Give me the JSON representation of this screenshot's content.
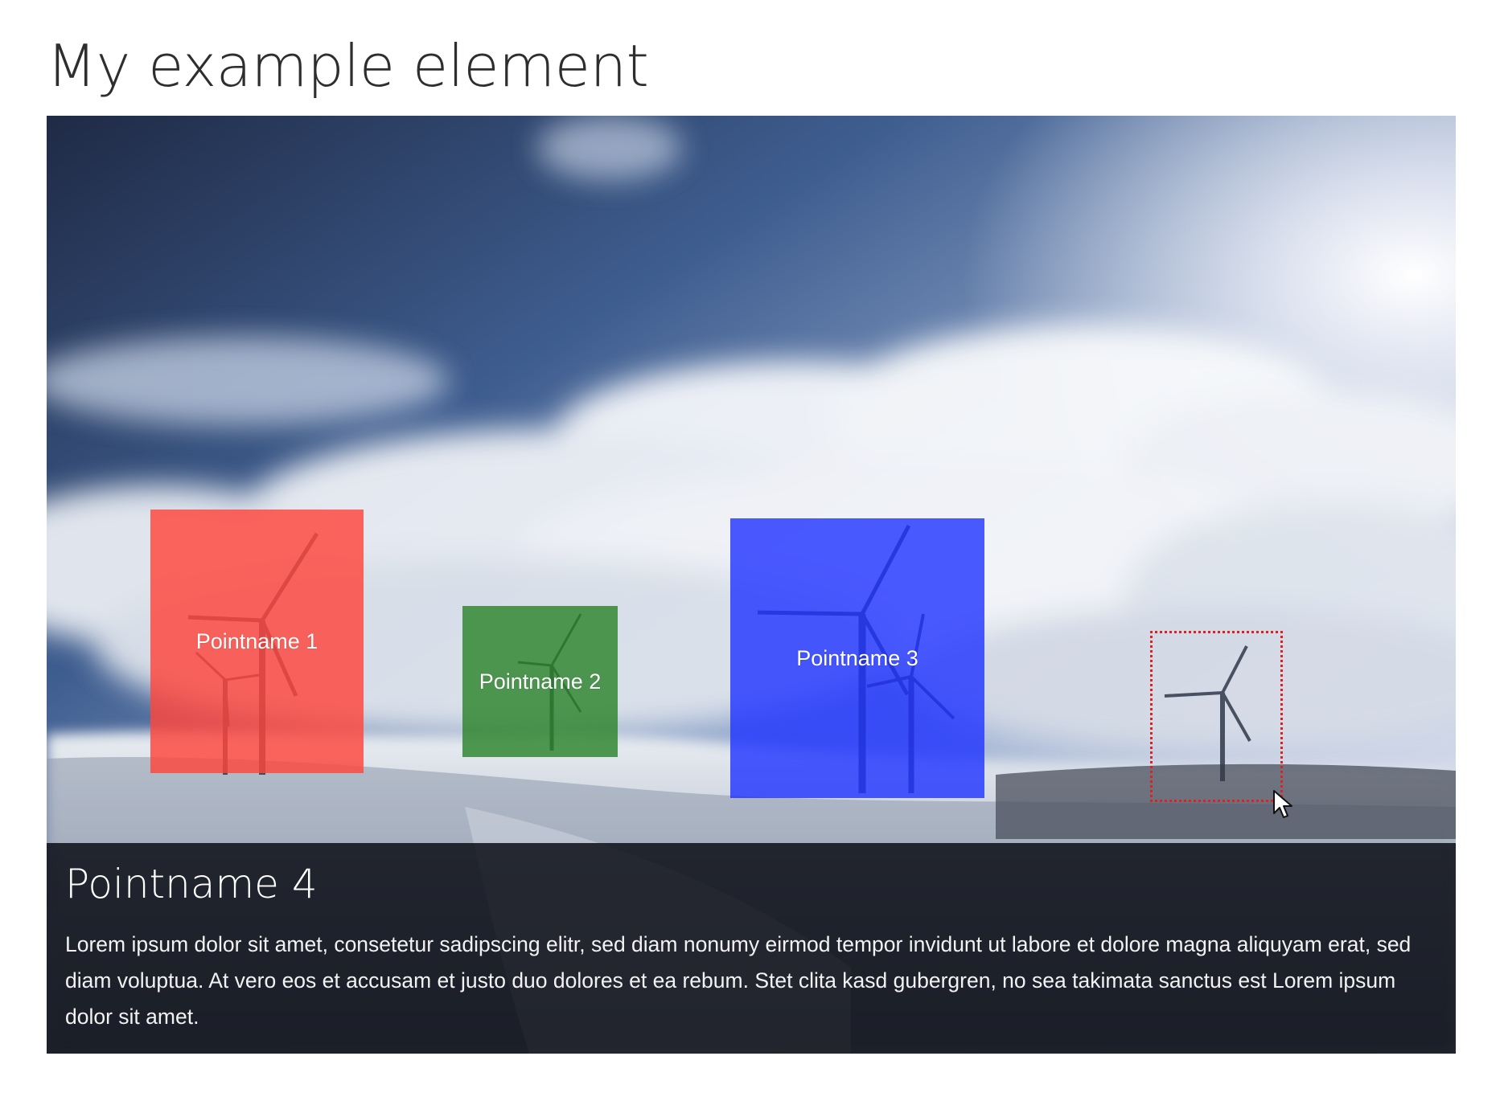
{
  "page": {
    "title": "My example element"
  },
  "hotspots": [
    {
      "label": "Pointname 1",
      "color": "#ff463c"
    },
    {
      "label": "Pointname 2",
      "color": "#288228"
    },
    {
      "label": "Pointname 3",
      "color": "#1e32ff"
    },
    {
      "label": "",
      "color": "#e0201a",
      "style": "dotted-outline",
      "state": "hovered"
    }
  ],
  "info_panel": {
    "title": "Pointname 4",
    "text": "Lorem ipsum dolor sit amet, consetetur sadipscing elitr, sed diam nonumy eirmod tempor invidunt ut labore et dolore magna aliquyam erat, sed diam voluptua. At vero eos et accusam et justo duo dolores et ea rebum. Stet clita kasd gubergren, no sea takimata sanctus est Lorem ipsum dolor sit amet."
  },
  "background_image": {
    "subject": "wind-turbines-on-snowy-hill-under-cloudy-sky"
  },
  "icons": {
    "cursor": "mouse-pointer-icon",
    "turbine": "wind-turbine-icon"
  }
}
